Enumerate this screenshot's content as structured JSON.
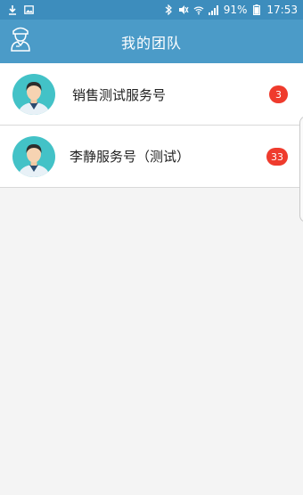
{
  "status_bar": {
    "battery": "91%",
    "time": "17:53"
  },
  "header": {
    "title": "我的团队"
  },
  "contacts": [
    {
      "name": "销售测试服务号",
      "unread": "3"
    },
    {
      "name": "李静服务号（测试）",
      "unread": "33"
    }
  ],
  "colors": {
    "status_bar": "#3d8dbd",
    "app_bar": "#4b9bc8",
    "badge": "#ef3b2d",
    "avatar_bg": "#43c2c7"
  }
}
